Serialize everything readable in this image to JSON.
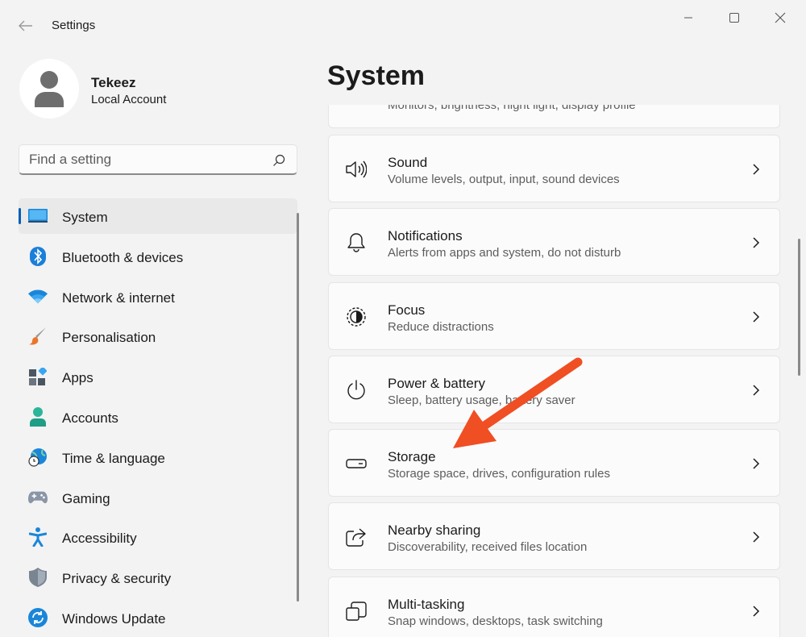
{
  "window": {
    "title": "Settings"
  },
  "profile": {
    "name": "Tekeez",
    "account_type": "Local Account"
  },
  "search": {
    "placeholder": "Find a setting"
  },
  "sidebar": {
    "items": [
      {
        "label": "System",
        "icon": "monitor-icon",
        "active": true
      },
      {
        "label": "Bluetooth & devices",
        "icon": "bluetooth-icon"
      },
      {
        "label": "Network & internet",
        "icon": "wifi-icon"
      },
      {
        "label": "Personalisation",
        "icon": "paintbrush-icon"
      },
      {
        "label": "Apps",
        "icon": "apps-icon"
      },
      {
        "label": "Accounts",
        "icon": "person-icon"
      },
      {
        "label": "Time & language",
        "icon": "globe-clock-icon"
      },
      {
        "label": "Gaming",
        "icon": "gamepad-icon"
      },
      {
        "label": "Accessibility",
        "icon": "accessibility-icon"
      },
      {
        "label": "Privacy & security",
        "icon": "shield-icon"
      },
      {
        "label": "Windows Update",
        "icon": "update-icon"
      }
    ]
  },
  "main": {
    "title": "System",
    "cards": [
      {
        "title": "",
        "desc": "Monitors, brightness, night light, display profile",
        "icon": "display-icon"
      },
      {
        "title": "Sound",
        "desc": "Volume levels, output, input, sound devices",
        "icon": "speaker-icon"
      },
      {
        "title": "Notifications",
        "desc": "Alerts from apps and system, do not disturb",
        "icon": "bell-icon"
      },
      {
        "title": "Focus",
        "desc": "Reduce distractions",
        "icon": "focus-icon"
      },
      {
        "title": "Power & battery",
        "desc": "Sleep, battery usage, battery saver",
        "icon": "power-icon"
      },
      {
        "title": "Storage",
        "desc": "Storage space, drives, configuration rules",
        "icon": "storage-icon"
      },
      {
        "title": "Nearby sharing",
        "desc": "Discoverability, received files location",
        "icon": "share-icon"
      },
      {
        "title": "Multi-tasking",
        "desc": "Snap windows, desktops, task switching",
        "icon": "multitask-icon"
      }
    ]
  },
  "colors": {
    "accent": "#005fb8",
    "annotation_arrow": "#f04e23"
  }
}
